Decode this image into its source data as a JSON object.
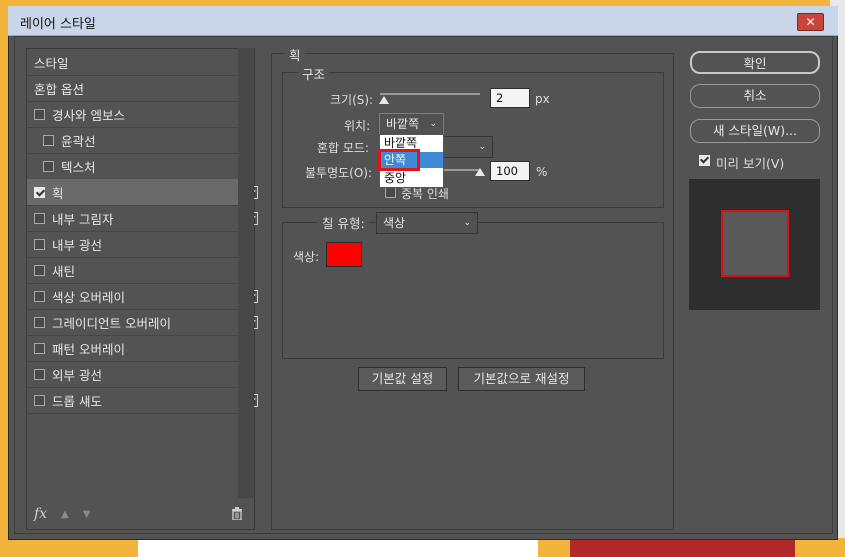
{
  "dialog": {
    "title": "레이어 스타일",
    "close_label": "✕"
  },
  "styles_list": [
    {
      "label": "스타일",
      "checkbox": false,
      "plus": false,
      "indent": false,
      "selected": false,
      "has_checkbox": false
    },
    {
      "label": "혼합 옵션",
      "checkbox": false,
      "plus": false,
      "indent": false,
      "selected": false,
      "has_checkbox": false
    },
    {
      "label": "경사와 엠보스",
      "checkbox": false,
      "plus": false,
      "indent": false,
      "selected": false,
      "has_checkbox": true
    },
    {
      "label": "윤곽선",
      "checkbox": false,
      "plus": false,
      "indent": true,
      "selected": false,
      "has_checkbox": true
    },
    {
      "label": "텍스처",
      "checkbox": false,
      "plus": false,
      "indent": true,
      "selected": false,
      "has_checkbox": true
    },
    {
      "label": "획",
      "checkbox": true,
      "plus": true,
      "indent": false,
      "selected": true,
      "has_checkbox": true
    },
    {
      "label": "내부 그림자",
      "checkbox": false,
      "plus": true,
      "indent": false,
      "selected": false,
      "has_checkbox": true
    },
    {
      "label": "내부 광선",
      "checkbox": false,
      "plus": false,
      "indent": false,
      "selected": false,
      "has_checkbox": true
    },
    {
      "label": "새틴",
      "checkbox": false,
      "plus": false,
      "indent": false,
      "selected": false,
      "has_checkbox": true
    },
    {
      "label": "색상 오버레이",
      "checkbox": false,
      "plus": true,
      "indent": false,
      "selected": false,
      "has_checkbox": true
    },
    {
      "label": "그레이디언트 오버레이",
      "checkbox": false,
      "plus": true,
      "indent": false,
      "selected": false,
      "has_checkbox": true
    },
    {
      "label": "패턴 오버레이",
      "checkbox": false,
      "plus": false,
      "indent": false,
      "selected": false,
      "has_checkbox": true
    },
    {
      "label": "외부 광선",
      "checkbox": false,
      "plus": false,
      "indent": false,
      "selected": false,
      "has_checkbox": true
    },
    {
      "label": "드롭 섀도",
      "checkbox": false,
      "plus": true,
      "indent": false,
      "selected": false,
      "has_checkbox": true
    }
  ],
  "footer": {
    "fx_label": "fx",
    "up_icon": "▲",
    "down_icon": "▼",
    "trash_icon": "🗑"
  },
  "stroke": {
    "section_title": "획",
    "structure_title": "구조",
    "size_label": "크기(S):",
    "size_value": "2",
    "size_unit": "px",
    "position_label": "위치:",
    "position_value": "바깥쪽",
    "position_options": [
      "바깥쪽",
      "안쪽",
      "중앙"
    ],
    "position_highlighted": "안쪽",
    "blend_label": "혼합 모드:",
    "opacity_label": "불투명도(O):",
    "opacity_value": "100",
    "opacity_unit": "%",
    "overprint_label": "중복 인쇄",
    "fill_type_label": "칠 유형:",
    "fill_type_value": "색상",
    "color_label": "색상:",
    "color_value": "#ff0000"
  },
  "buttons": {
    "default_set": "기본값 설정",
    "reset_default": "기본값으로 재설정",
    "ok": "확인",
    "cancel": "취소",
    "new_style": "새 스타일(W)...",
    "preview_label": "미리 보기(V)"
  },
  "colors": {
    "dialog_bg": "#535353",
    "titlebar": "#c9d6ea",
    "highlight": "#3d8bd8",
    "stroke_color": "#e01010"
  }
}
